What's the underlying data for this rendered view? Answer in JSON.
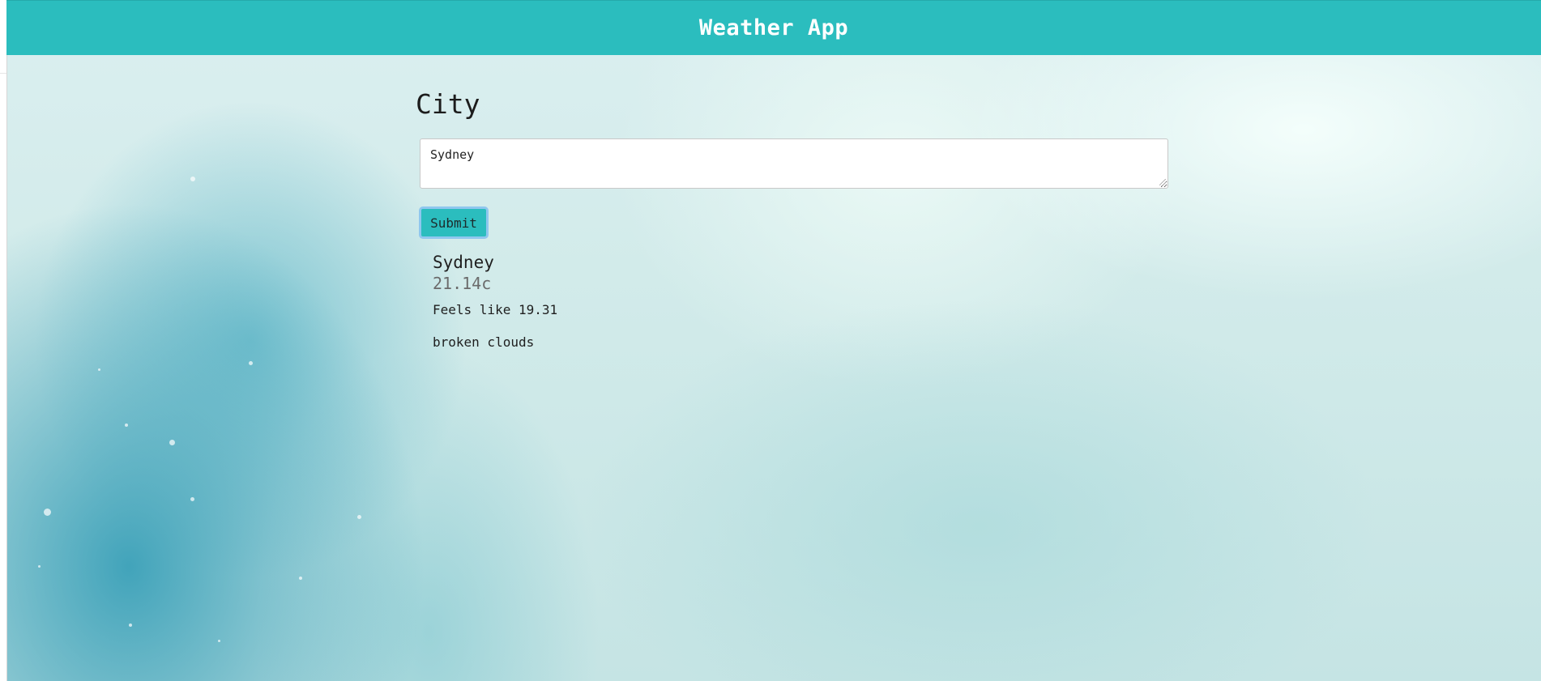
{
  "header": {
    "title": "Weather App"
  },
  "form": {
    "heading": "City",
    "city_input_value": "Sydney",
    "submit_label": "Submit"
  },
  "result": {
    "city": "Sydney",
    "temperature": "21.14c",
    "feels_like": "Feels like 19.31",
    "description": "broken clouds"
  },
  "colors": {
    "header_bg": "#2bbdbe",
    "button_bg": "#2bbdbe",
    "button_focus_ring": "#8fc7ee"
  }
}
